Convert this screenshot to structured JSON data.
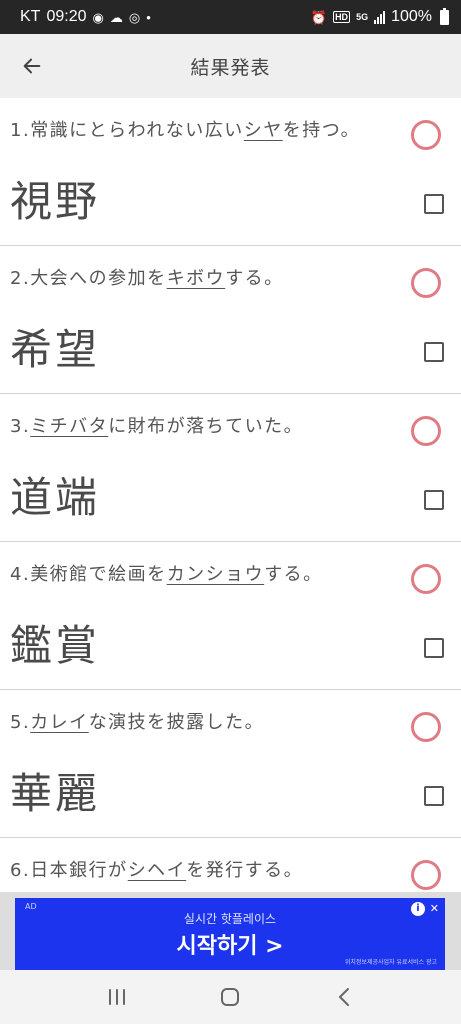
{
  "status": {
    "carrier": "KT",
    "time": "09:20",
    "network": "5G",
    "hd": "HD",
    "battery": "100%",
    "dot": "•"
  },
  "header": {
    "title": "結果発表",
    "back_icon": "arrow-left-icon"
  },
  "items": [
    {
      "num": "1.",
      "before": "常識にとらわれない広い",
      "target": "シヤ",
      "after": "を持つ。",
      "answer": "視野"
    },
    {
      "num": "2.",
      "before": "大会への参加を",
      "target": "キボウ",
      "after": "する。",
      "answer": "希望"
    },
    {
      "num": "3.",
      "before": "",
      "target": "ミチバタ",
      "after": "に財布が落ちていた。",
      "answer": "道端"
    },
    {
      "num": "4.",
      "before": "美術館で絵画を",
      "target": "カンショウ",
      "after": "する。",
      "answer": "鑑賞"
    },
    {
      "num": "5.",
      "before": "",
      "target": "カレイ",
      "after": "な演技を披露した。",
      "answer": "華麗"
    },
    {
      "num": "6.",
      "before": "日本銀行が",
      "target": "シヘイ",
      "after": "を発行する。",
      "answer": ""
    }
  ],
  "colors": {
    "correct_circle": "#e07b83",
    "ad_background": "#1c34ee"
  },
  "ad": {
    "tag": "AD",
    "subtitle": "실시간 핫플레이스",
    "main": "시작하기 >",
    "info": "i",
    "close": "✕",
    "footnote": "위치정보제공사업자 유료서비스 광고"
  }
}
